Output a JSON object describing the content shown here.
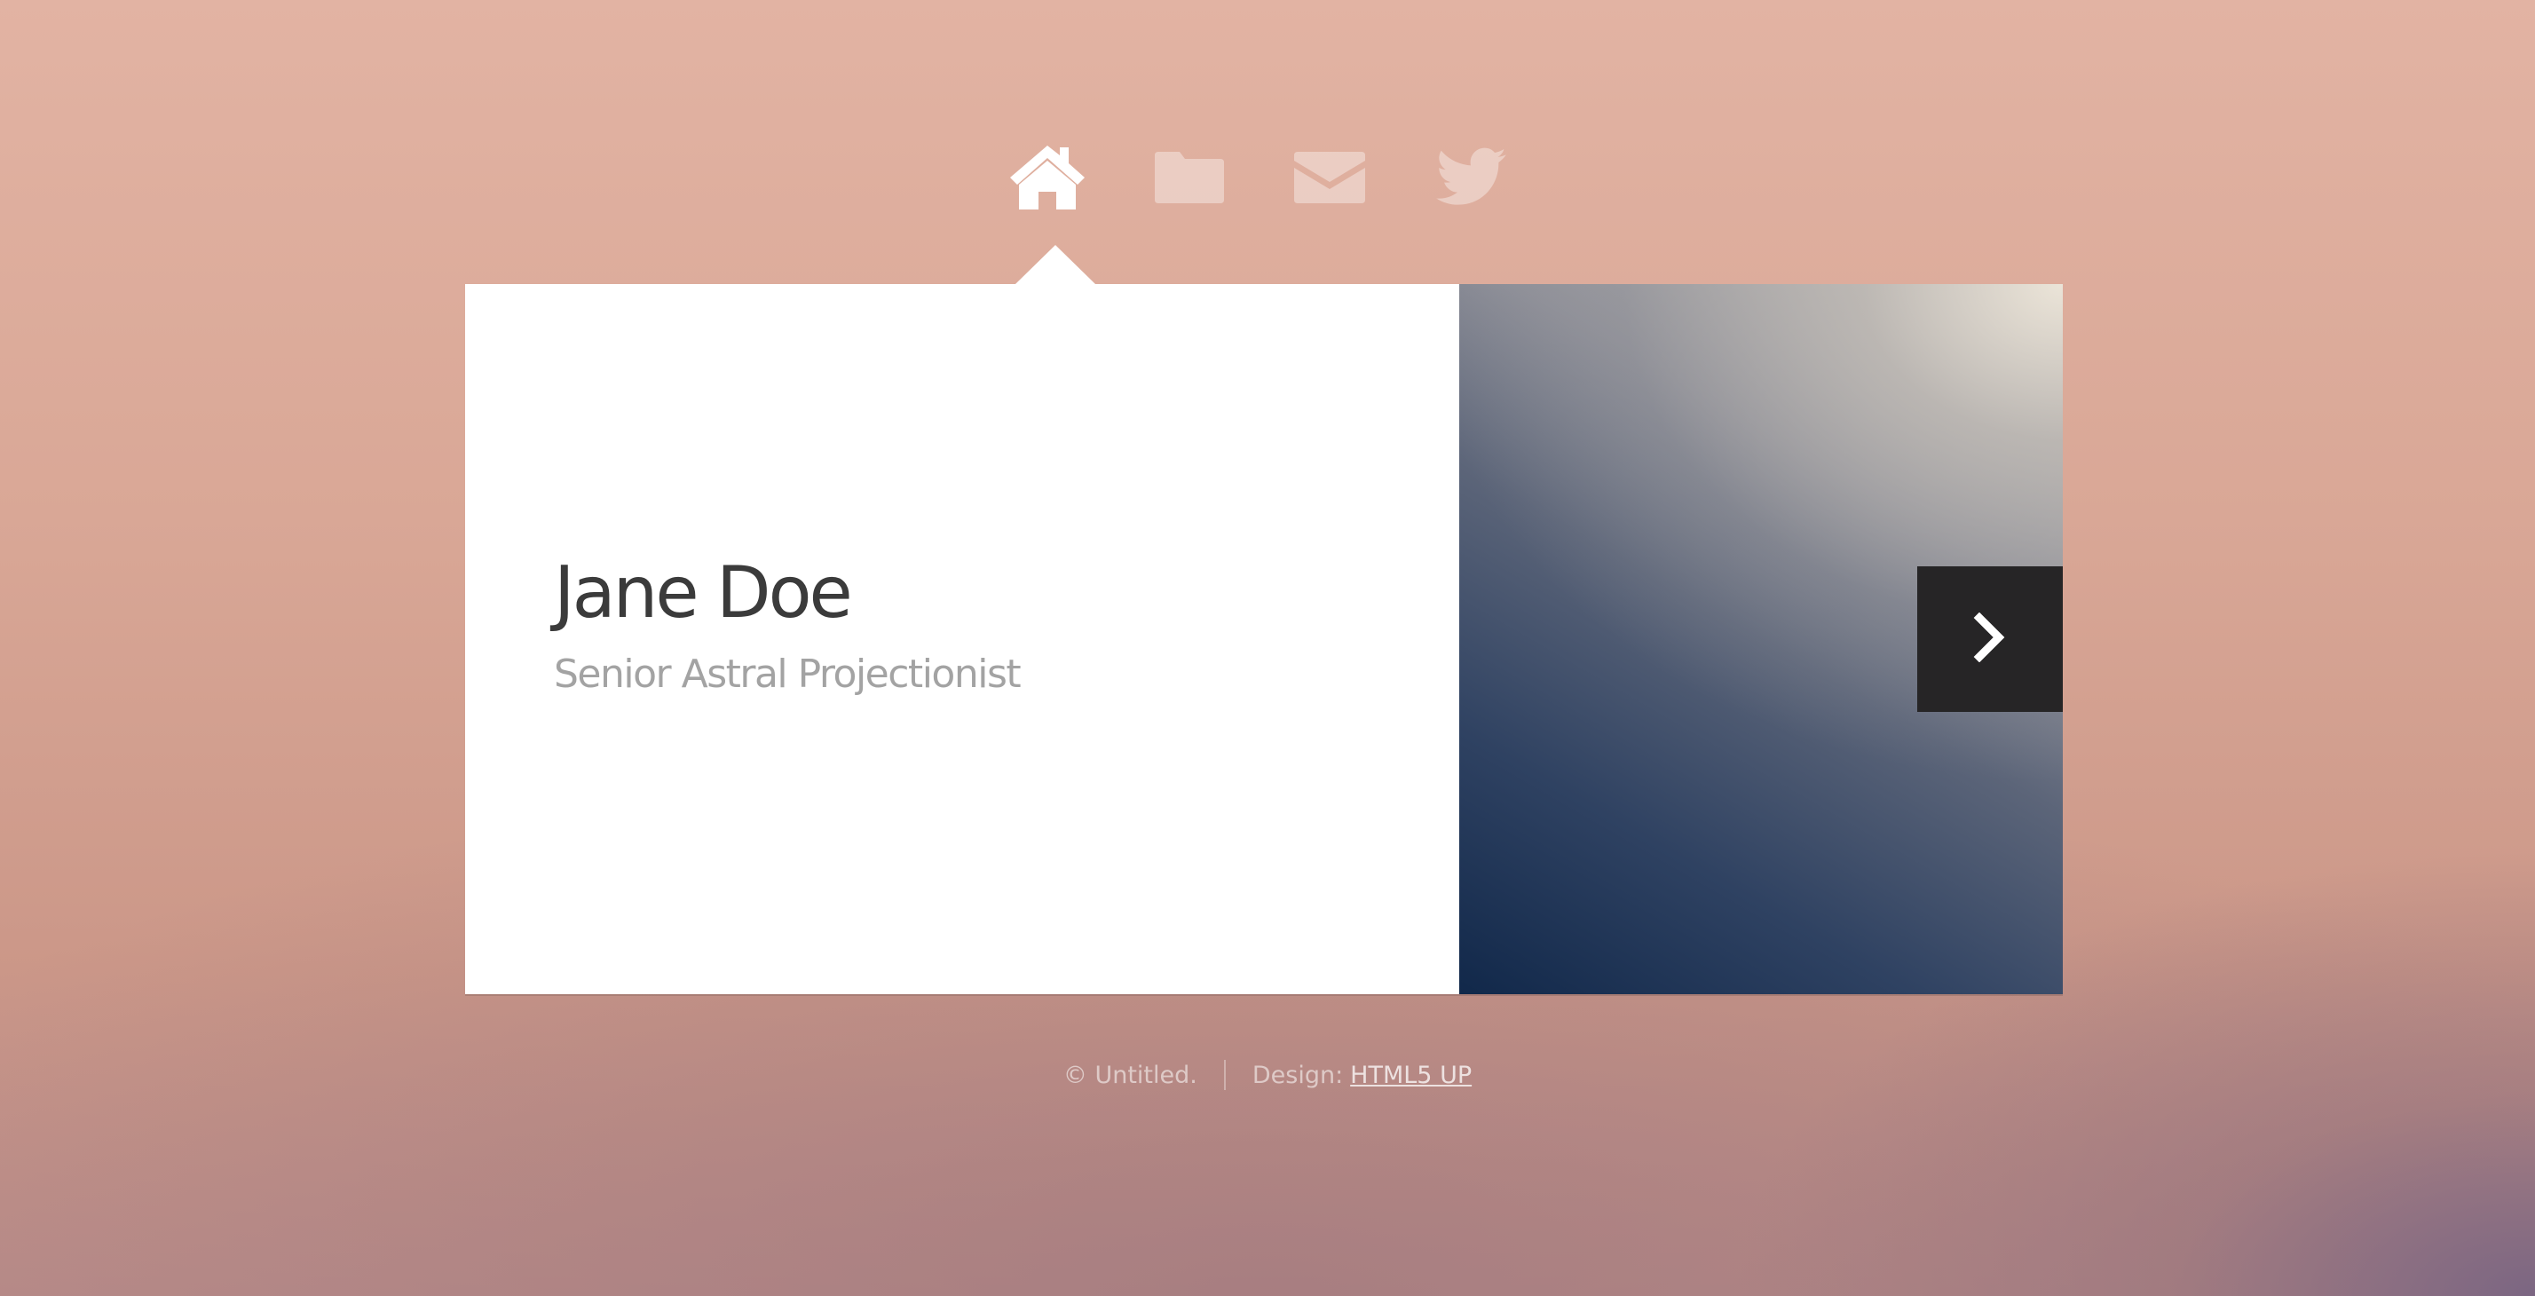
{
  "nav": {
    "items": [
      {
        "icon": "home-icon",
        "active": true
      },
      {
        "icon": "folder-icon",
        "active": false
      },
      {
        "icon": "envelope-icon",
        "active": false
      },
      {
        "icon": "twitter-icon",
        "active": false
      }
    ]
  },
  "profile": {
    "name": "Jane Doe",
    "title": "Senior Astral Projectionist"
  },
  "footer": {
    "copyright": "© Untitled.",
    "design_label": "Design:",
    "design_link": "HTML5 UP"
  },
  "colors": {
    "panel_bg": "#ffffff",
    "name_text": "#3b3b3b",
    "title_text": "#a3a3a3",
    "next_button_bg": "#262526"
  }
}
